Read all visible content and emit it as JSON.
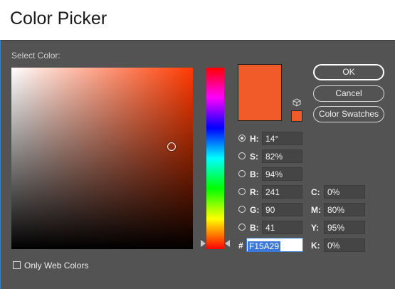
{
  "window": {
    "title": "Color Picker"
  },
  "picker": {
    "select_label": "Select Color:",
    "current_color": "#F15A29",
    "hue_base_color": "#FF3A00"
  },
  "buttons": {
    "ok": "OK",
    "cancel": "Cancel",
    "swatches": "Color Swatches"
  },
  "hsb": [
    {
      "label": "H:",
      "value": "14°",
      "selected": true
    },
    {
      "label": "S:",
      "value": "82%",
      "selected": false
    },
    {
      "label": "B:",
      "value": "94%",
      "selected": false
    }
  ],
  "rgb": [
    {
      "label": "R:",
      "value": "241",
      "selected": false
    },
    {
      "label": "G:",
      "value": "90",
      "selected": false
    },
    {
      "label": "B:",
      "value": "41",
      "selected": false
    }
  ],
  "cmyk": [
    {
      "label": "C:",
      "value": "0%"
    },
    {
      "label": "M:",
      "value": "80%"
    },
    {
      "label": "Y:",
      "value": "95%"
    },
    {
      "label": "K:",
      "value": "0%"
    }
  ],
  "hex": {
    "label": "#",
    "value": "F15A29"
  },
  "web_colors": {
    "label": "Only Web Colors",
    "checked": false
  },
  "icons": {
    "gamut": "cube-icon"
  }
}
